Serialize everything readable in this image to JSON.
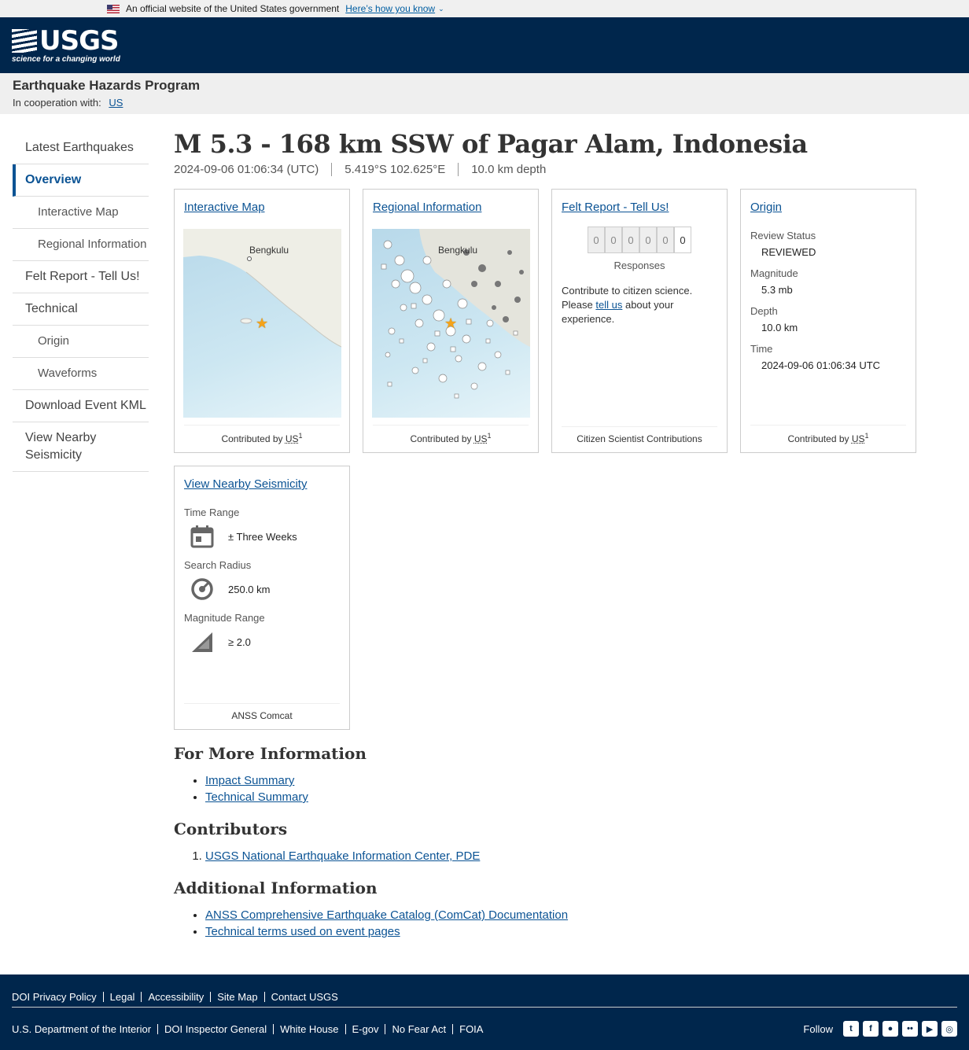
{
  "gov_banner": {
    "text": "An official website of the United States government",
    "link": "Here’s how you know"
  },
  "header": {
    "logo_text": "USGS",
    "tagline": "science for a changing world"
  },
  "program": {
    "title": "Earthquake Hazards Program",
    "coop_label": "In cooperation with:",
    "coop_link": "US"
  },
  "sidebar": {
    "items": [
      {
        "label": "Latest Earthquakes"
      },
      {
        "label": "Overview"
      },
      {
        "label": "Interactive Map"
      },
      {
        "label": "Regional Information"
      },
      {
        "label": "Felt Report - Tell Us!"
      },
      {
        "label": "Technical"
      },
      {
        "label": "Origin"
      },
      {
        "label": "Waveforms"
      },
      {
        "label": "Download Event KML"
      },
      {
        "label": "View Nearby Seismicity"
      }
    ]
  },
  "event": {
    "title": "M 5.3 - 168 km SSW of Pagar Alam, Indonesia",
    "time": "2024-09-06 01:06:34 (UTC)",
    "location": "5.419°S 102.625°E",
    "depth": "10.0 km depth"
  },
  "cards": {
    "interactive_map": {
      "title": "Interactive Map",
      "city": "Bengkulu",
      "footer_prefix": "Contributed by",
      "footer_abbr": "US",
      "footer_sup": "1"
    },
    "regional": {
      "title": "Regional Information",
      "city": "Bengkulu",
      "footer_prefix": "Contributed by",
      "footer_abbr": "US",
      "footer_sup": "1"
    },
    "felt": {
      "title": "Felt Report - Tell Us!",
      "digits": [
        "0",
        "0",
        "0",
        "0",
        "0",
        "0"
      ],
      "responses": "Responses",
      "text_before": "Contribute to citizen science. Please",
      "link": "tell us",
      "text_after": "about your experience.",
      "footer": "Citizen Scientist Contributions"
    },
    "origin": {
      "title": "Origin",
      "review_label": "Review Status",
      "review_value": "REVIEWED",
      "magnitude_label": "Magnitude",
      "magnitude_value": "5.3 mb",
      "depth_label": "Depth",
      "depth_value": "10.0 km",
      "time_label": "Time",
      "time_value": "2024-09-06 01:06:34 UTC",
      "footer_prefix": "Contributed by",
      "footer_abbr": "US",
      "footer_sup": "1"
    },
    "nearby": {
      "title": "View Nearby Seismicity",
      "time_label": "Time Range",
      "time_value": "± Three Weeks",
      "radius_label": "Search Radius",
      "radius_value": "250.0 km",
      "mag_label": "Magnitude Range",
      "mag_value": "≥ 2.0",
      "footer": "ANSS Comcat"
    }
  },
  "more_info": {
    "heading": "For More Information",
    "links": [
      "Impact Summary",
      "Technical Summary"
    ]
  },
  "contributors": {
    "heading": "Contributors",
    "links": [
      "USGS National Earthquake Information Center, PDE"
    ]
  },
  "additional": {
    "heading": "Additional Information",
    "links": [
      "ANSS Comprehensive Earthquake Catalog (ComCat) Documentation",
      "Technical terms used on event pages"
    ]
  },
  "footer": {
    "row1": [
      "DOI Privacy Policy",
      "Legal",
      "Accessibility",
      "Site Map",
      "Contact USGS"
    ],
    "row2": [
      "U.S. Department of the Interior",
      "DOI Inspector General",
      "White House",
      "E-gov",
      "No Fear Act",
      "FOIA"
    ],
    "follow": "Follow"
  }
}
